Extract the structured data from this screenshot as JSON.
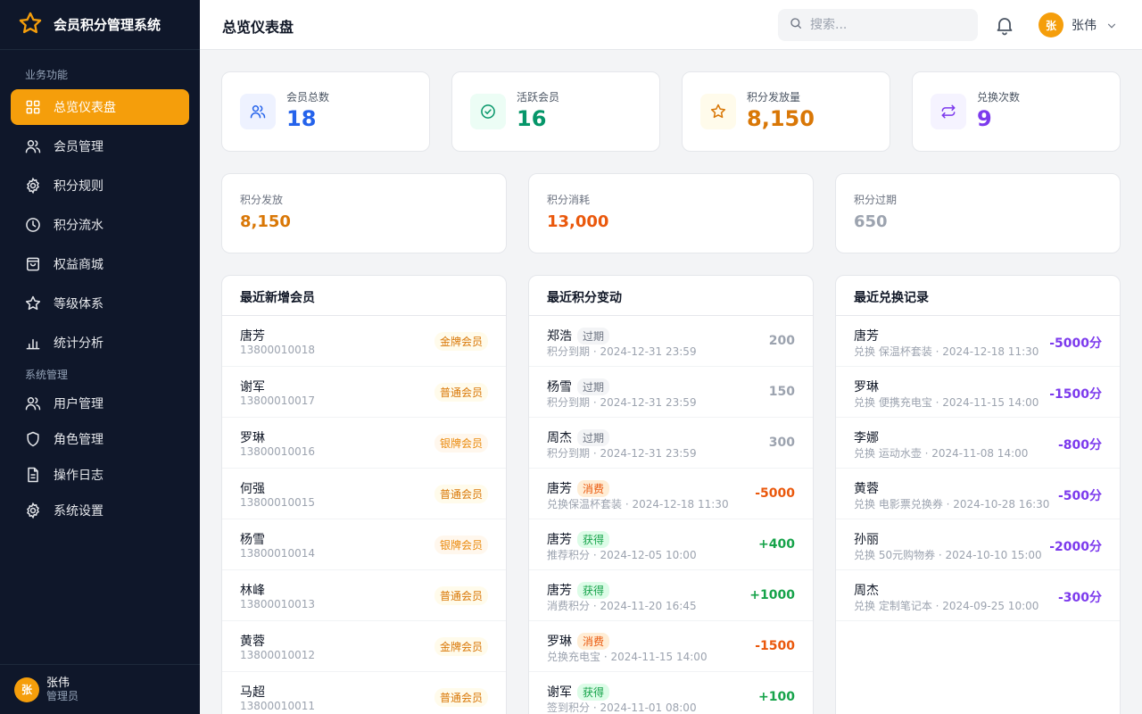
{
  "app": {
    "title": "会员积分管理系统"
  },
  "sidebar": {
    "section_business": "业务功能",
    "section_system": "系统管理",
    "items": [
      {
        "label": "总览仪表盘",
        "icon": "dashboard-icon"
      },
      {
        "label": "会员管理",
        "icon": "users-icon"
      },
      {
        "label": "积分规则",
        "icon": "gear-icon"
      },
      {
        "label": "积分流水",
        "icon": "clock-icon"
      },
      {
        "label": "权益商城",
        "icon": "shopping-bag-icon"
      },
      {
        "label": "等级体系",
        "icon": "star-icon"
      },
      {
        "label": "统计分析",
        "icon": "bar-chart-icon"
      },
      {
        "label": "用户管理",
        "icon": "users-icon"
      },
      {
        "label": "角色管理",
        "icon": "shield-icon"
      },
      {
        "label": "操作日志",
        "icon": "document-icon"
      },
      {
        "label": "系统设置",
        "icon": "gear-icon"
      }
    ],
    "user": {
      "avatar": "张",
      "name": "张伟",
      "role": "管理员"
    }
  },
  "header": {
    "title": "总览仪表盘",
    "search_placeholder": "搜索...",
    "user": {
      "avatar": "张",
      "name": "张伟"
    }
  },
  "stats": [
    {
      "label": "会员总数",
      "value": "18",
      "color": "#2563eb",
      "bg": "#eef2ff",
      "icon": "users-icon"
    },
    {
      "label": "活跃会员",
      "value": "16",
      "color": "#059669",
      "bg": "#ecfdf5",
      "icon": "check-circle-icon"
    },
    {
      "label": "积分发放量",
      "value": "8,150",
      "color": "#d97706",
      "bg": "#fffbeb",
      "icon": "star-icon"
    },
    {
      "label": "兑换次数",
      "value": "9",
      "color": "#7c3aed",
      "bg": "#f5f3ff",
      "icon": "swap-icon"
    }
  ],
  "summary": [
    {
      "label": "积分发放",
      "value": "8,150",
      "color": "#d97706"
    },
    {
      "label": "积分消耗",
      "value": "13,000",
      "color": "#ea580c"
    },
    {
      "label": "积分过期",
      "value": "650",
      "color": "#9ca3af"
    }
  ],
  "recent_members": {
    "title": "最近新增会员",
    "rows": [
      {
        "name": "唐芳",
        "phone": "13800010018",
        "level": "金牌会员"
      },
      {
        "name": "谢军",
        "phone": "13800010017",
        "level": "普通会员"
      },
      {
        "name": "罗琳",
        "phone": "13800010016",
        "level": "银牌会员"
      },
      {
        "name": "何强",
        "phone": "13800010015",
        "level": "普通会员"
      },
      {
        "name": "杨雪",
        "phone": "13800010014",
        "level": "银牌会员"
      },
      {
        "name": "林峰",
        "phone": "13800010013",
        "level": "普通会员"
      },
      {
        "name": "黄蓉",
        "phone": "13800010012",
        "level": "金牌会员"
      },
      {
        "name": "马超",
        "phone": "13800010011",
        "level": "普通会员"
      }
    ]
  },
  "recent_changes": {
    "title": "最近积分变动",
    "rows": [
      {
        "name": "郑浩",
        "tag": "过期",
        "desc": "积分到期 · 2024-12-31 23:59",
        "amount": "200",
        "kind": "expire"
      },
      {
        "name": "杨雪",
        "tag": "过期",
        "desc": "积分到期 · 2024-12-31 23:59",
        "amount": "150",
        "kind": "expire"
      },
      {
        "name": "周杰",
        "tag": "过期",
        "desc": "积分到期 · 2024-12-31 23:59",
        "amount": "300",
        "kind": "expire"
      },
      {
        "name": "唐芳",
        "tag": "消费",
        "desc": "兑换保温杯套装 · 2024-12-18 11:30",
        "amount": "-5000",
        "kind": "spend"
      },
      {
        "name": "唐芳",
        "tag": "获得",
        "desc": "推荐积分 · 2024-12-05 10:00",
        "amount": "+400",
        "kind": "earn"
      },
      {
        "name": "唐芳",
        "tag": "获得",
        "desc": "消费积分 · 2024-11-20 16:45",
        "amount": "+1000",
        "kind": "earn"
      },
      {
        "name": "罗琳",
        "tag": "消费",
        "desc": "兑换充电宝 · 2024-11-15 14:00",
        "amount": "-1500",
        "kind": "spend"
      },
      {
        "name": "谢军",
        "tag": "获得",
        "desc": "签到积分 · 2024-11-01 08:00",
        "amount": "+100",
        "kind": "earn"
      }
    ]
  },
  "recent_redemptions": {
    "title": "最近兑换记录",
    "rows": [
      {
        "name": "唐芳",
        "desc": "兑换 保温杯套装 · 2024-12-18 11:30",
        "amount": "-5000分"
      },
      {
        "name": "罗琳",
        "desc": "兑换 便携充电宝 · 2024-11-15 14:00",
        "amount": "-1500分"
      },
      {
        "name": "李娜",
        "desc": "兑换 运动水壶 · 2024-11-08 14:00",
        "amount": "-800分"
      },
      {
        "name": "黄蓉",
        "desc": "兑换 电影票兑换券 · 2024-10-28 16:30",
        "amount": "-500分"
      },
      {
        "name": "孙丽",
        "desc": "兑换 50元购物券 · 2024-10-10 15:00",
        "amount": "-2000分"
      },
      {
        "name": "周杰",
        "desc": "兑换 定制笔记本 · 2024-09-25 10:00",
        "amount": "-300分"
      }
    ]
  },
  "colors": {
    "accent": "#f59e0b",
    "sidebar_bg": "#0f172a",
    "gold_bg": "#fffbeb",
    "gold_fg": "#d97706",
    "silver_bg": "#fff7ed",
    "silver_fg": "#ea8a0c",
    "normal_bg": "#fffbeb",
    "normal_fg": "#d97706",
    "earn": "#16a34a",
    "spend": "#ea580c",
    "expire": "#9ca3af",
    "redeem": "#7c3aed"
  }
}
